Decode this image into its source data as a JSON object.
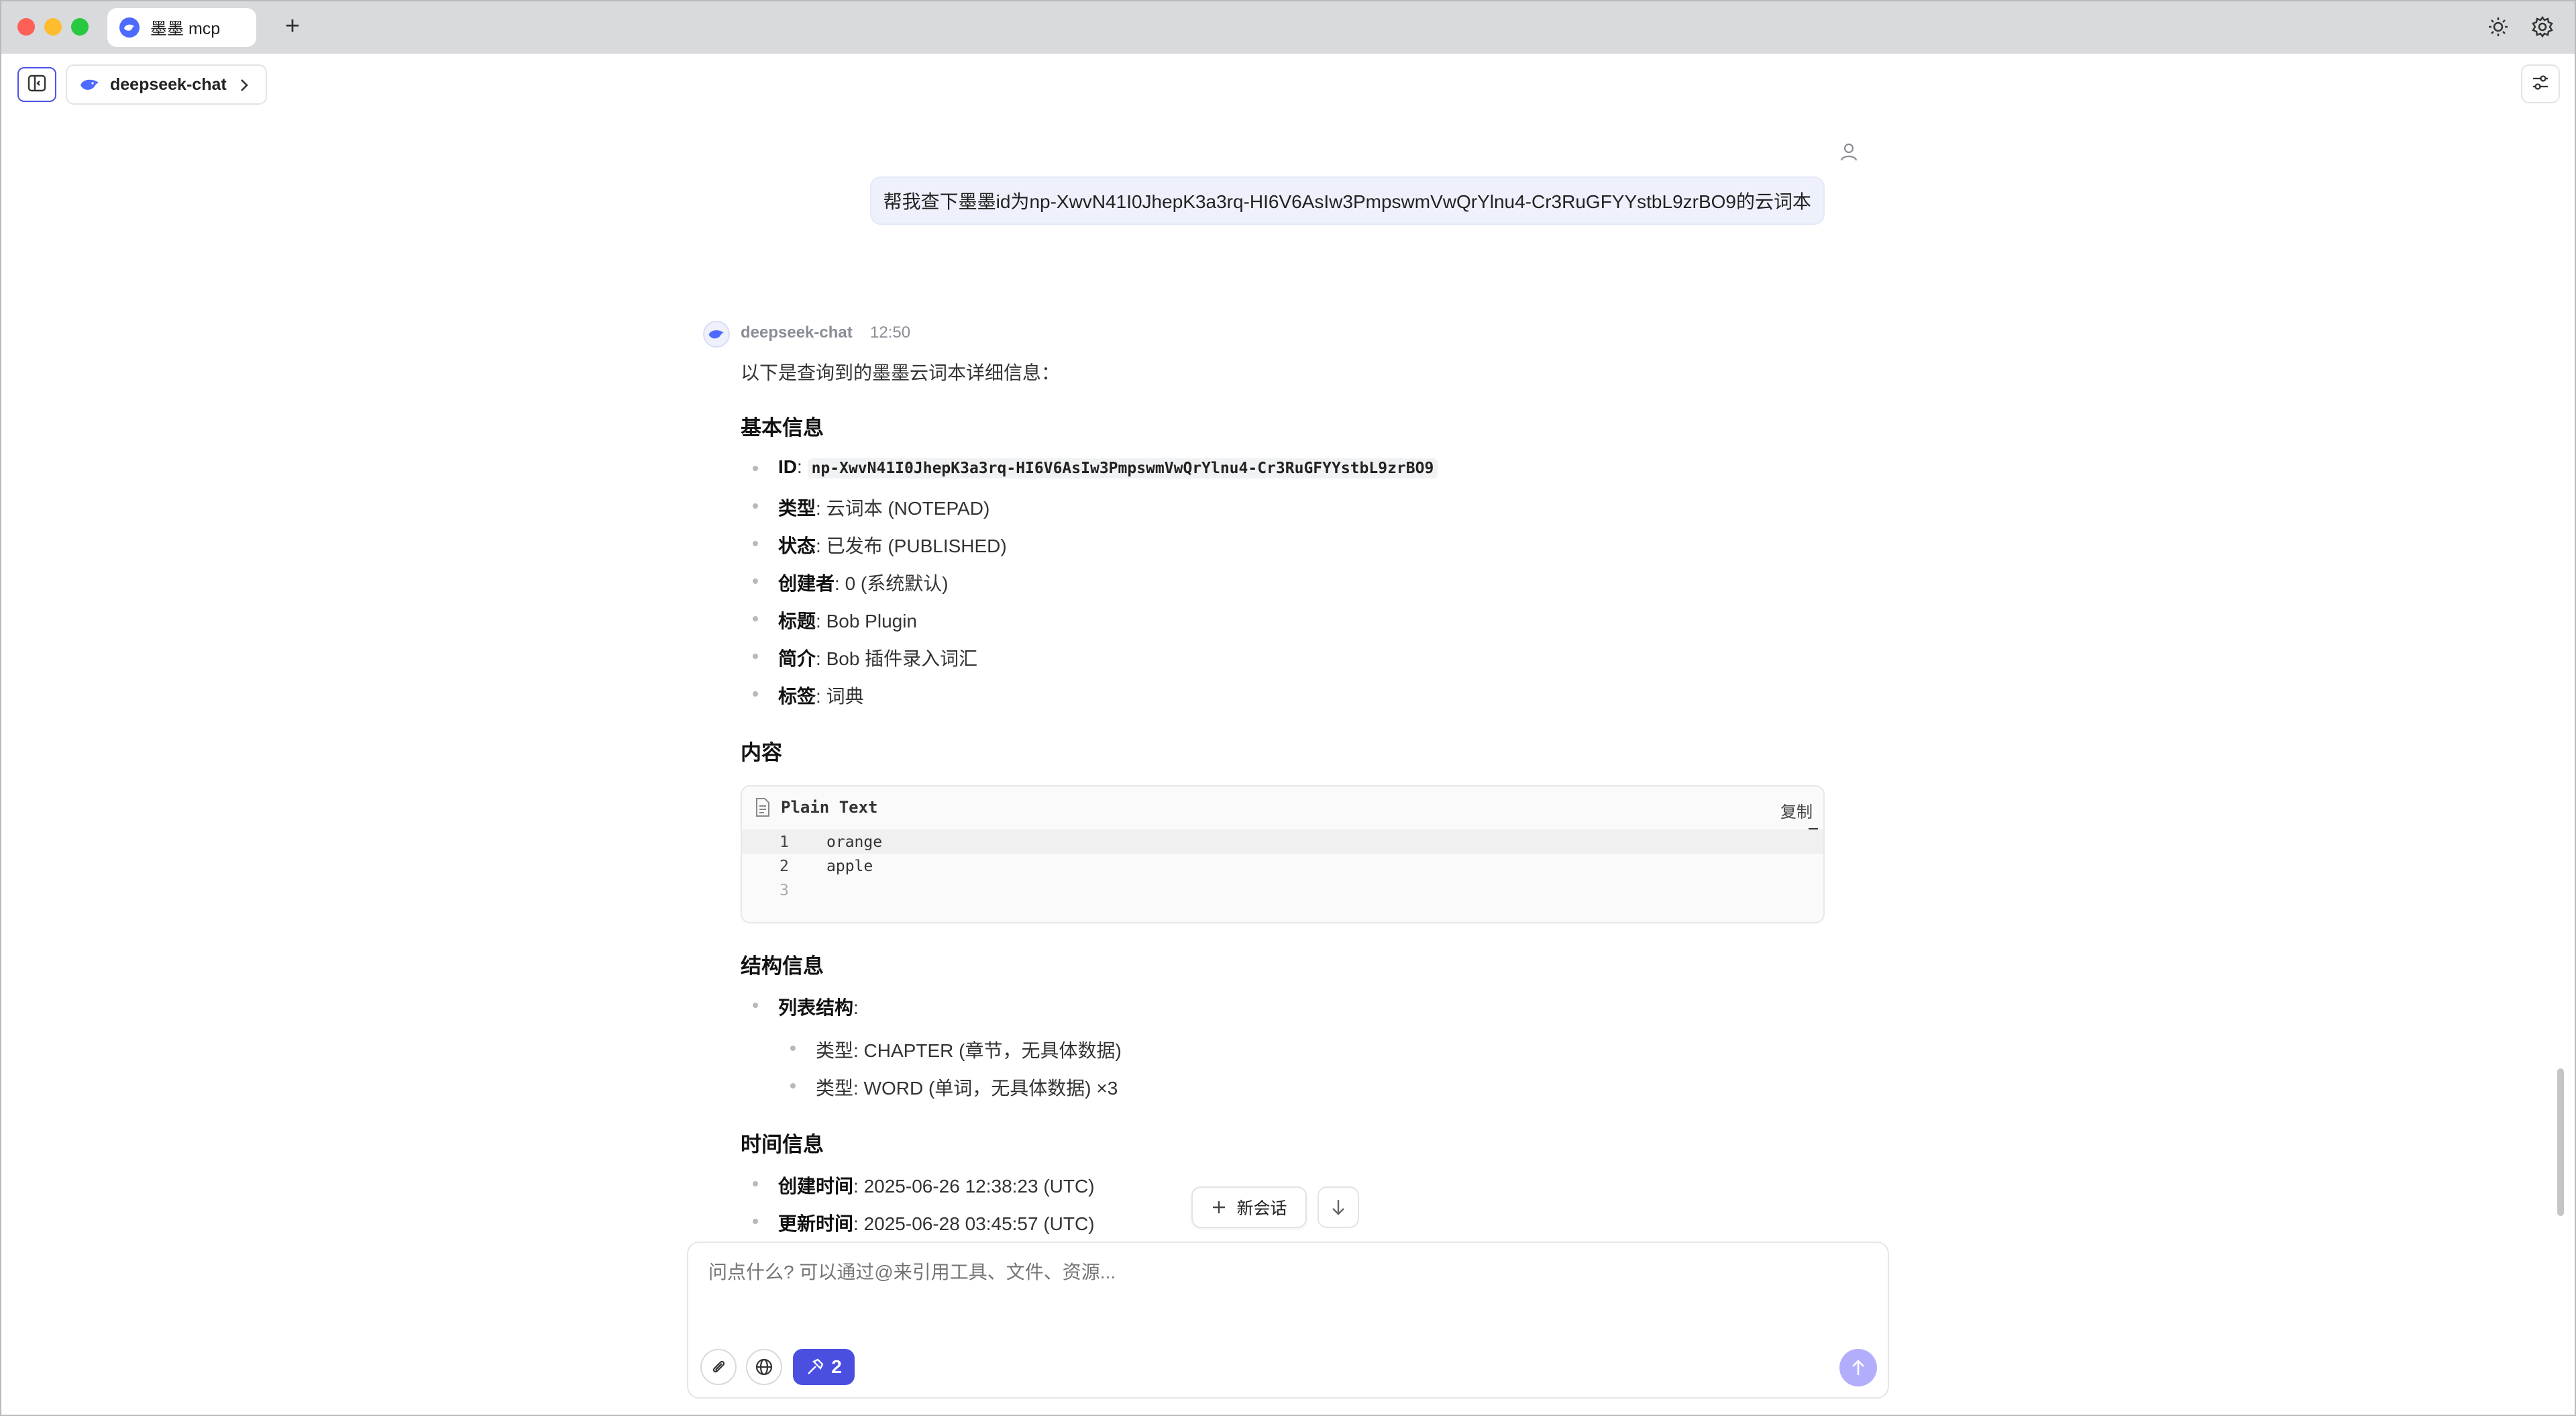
{
  "tab": {
    "title": "墨墨 mcp"
  },
  "header": {
    "model_name": "deepseek-chat"
  },
  "user_message": {
    "text": "帮我查下墨墨id为np-XwvN41I0JhepK3a3rq-HI6V6AsIw3PmpswmVwQrYlnu4-Cr3RuGFYYstbL9zrBO9的云词本"
  },
  "assistant": {
    "name": "deepseek-chat",
    "time": "12:50",
    "intro": "以下是查询到的墨墨云词本详细信息：",
    "section_basic": "基本信息",
    "basic_items": [
      {
        "key": "ID",
        "value": "np-XwvN41I0JhepK3a3rq-HI6V6AsIw3PmpswmVwQrYlnu4-Cr3RuGFYYstbL9zrBO9"
      },
      {
        "key": "类型",
        "value": ": 云词本 (NOTEPAD)"
      },
      {
        "key": "状态",
        "value": ": 已发布 (PUBLISHED)"
      },
      {
        "key": "创建者",
        "value": ": 0 (系统默认)"
      },
      {
        "key": "标题",
        "value": ": Bob Plugin"
      },
      {
        "key": "简介",
        "value": ": Bob 插件录入词汇"
      },
      {
        "key": "标签",
        "value": ": 词典"
      }
    ],
    "section_content": "内容",
    "code_block": {
      "language": "Plain Text",
      "copy_label": "复制",
      "lines": [
        {
          "num": "1",
          "text": "orange"
        },
        {
          "num": "2",
          "text": "apple"
        },
        {
          "num": "3",
          "text": ""
        }
      ]
    },
    "section_structure": "结构信息",
    "structure_label": "列表结构",
    "structure_items": [
      "类型: CHAPTER (章节，无具体数据)",
      "类型: WORD (单词，无具体数据) ×3"
    ],
    "section_time": "时间信息",
    "time_items": [
      {
        "key": "创建时间",
        "value": ": 2025-06-26 12:38:23 (UTC)"
      },
      {
        "key": "更新时间",
        "value": ": 2025-06-28 03:45:57 (UTC)"
      }
    ]
  },
  "floating": {
    "new_chat_label": "新会话"
  },
  "composer": {
    "placeholder": "问点什么? 可以通过@来引用工具、文件、资源...",
    "tools_count": "2"
  },
  "icons": {
    "sidebar_toggle": "sidebar-icon",
    "theme": "sun-icon",
    "settings": "gear-icon",
    "attach": "paperclip-icon",
    "web": "globe-icon",
    "tools": "hammer-icon",
    "send": "arrow-up-icon"
  },
  "colors": {
    "accent": "#4b4fe0",
    "send_disabled": "#b3aefc",
    "user_bubble": "#eef1fb"
  }
}
